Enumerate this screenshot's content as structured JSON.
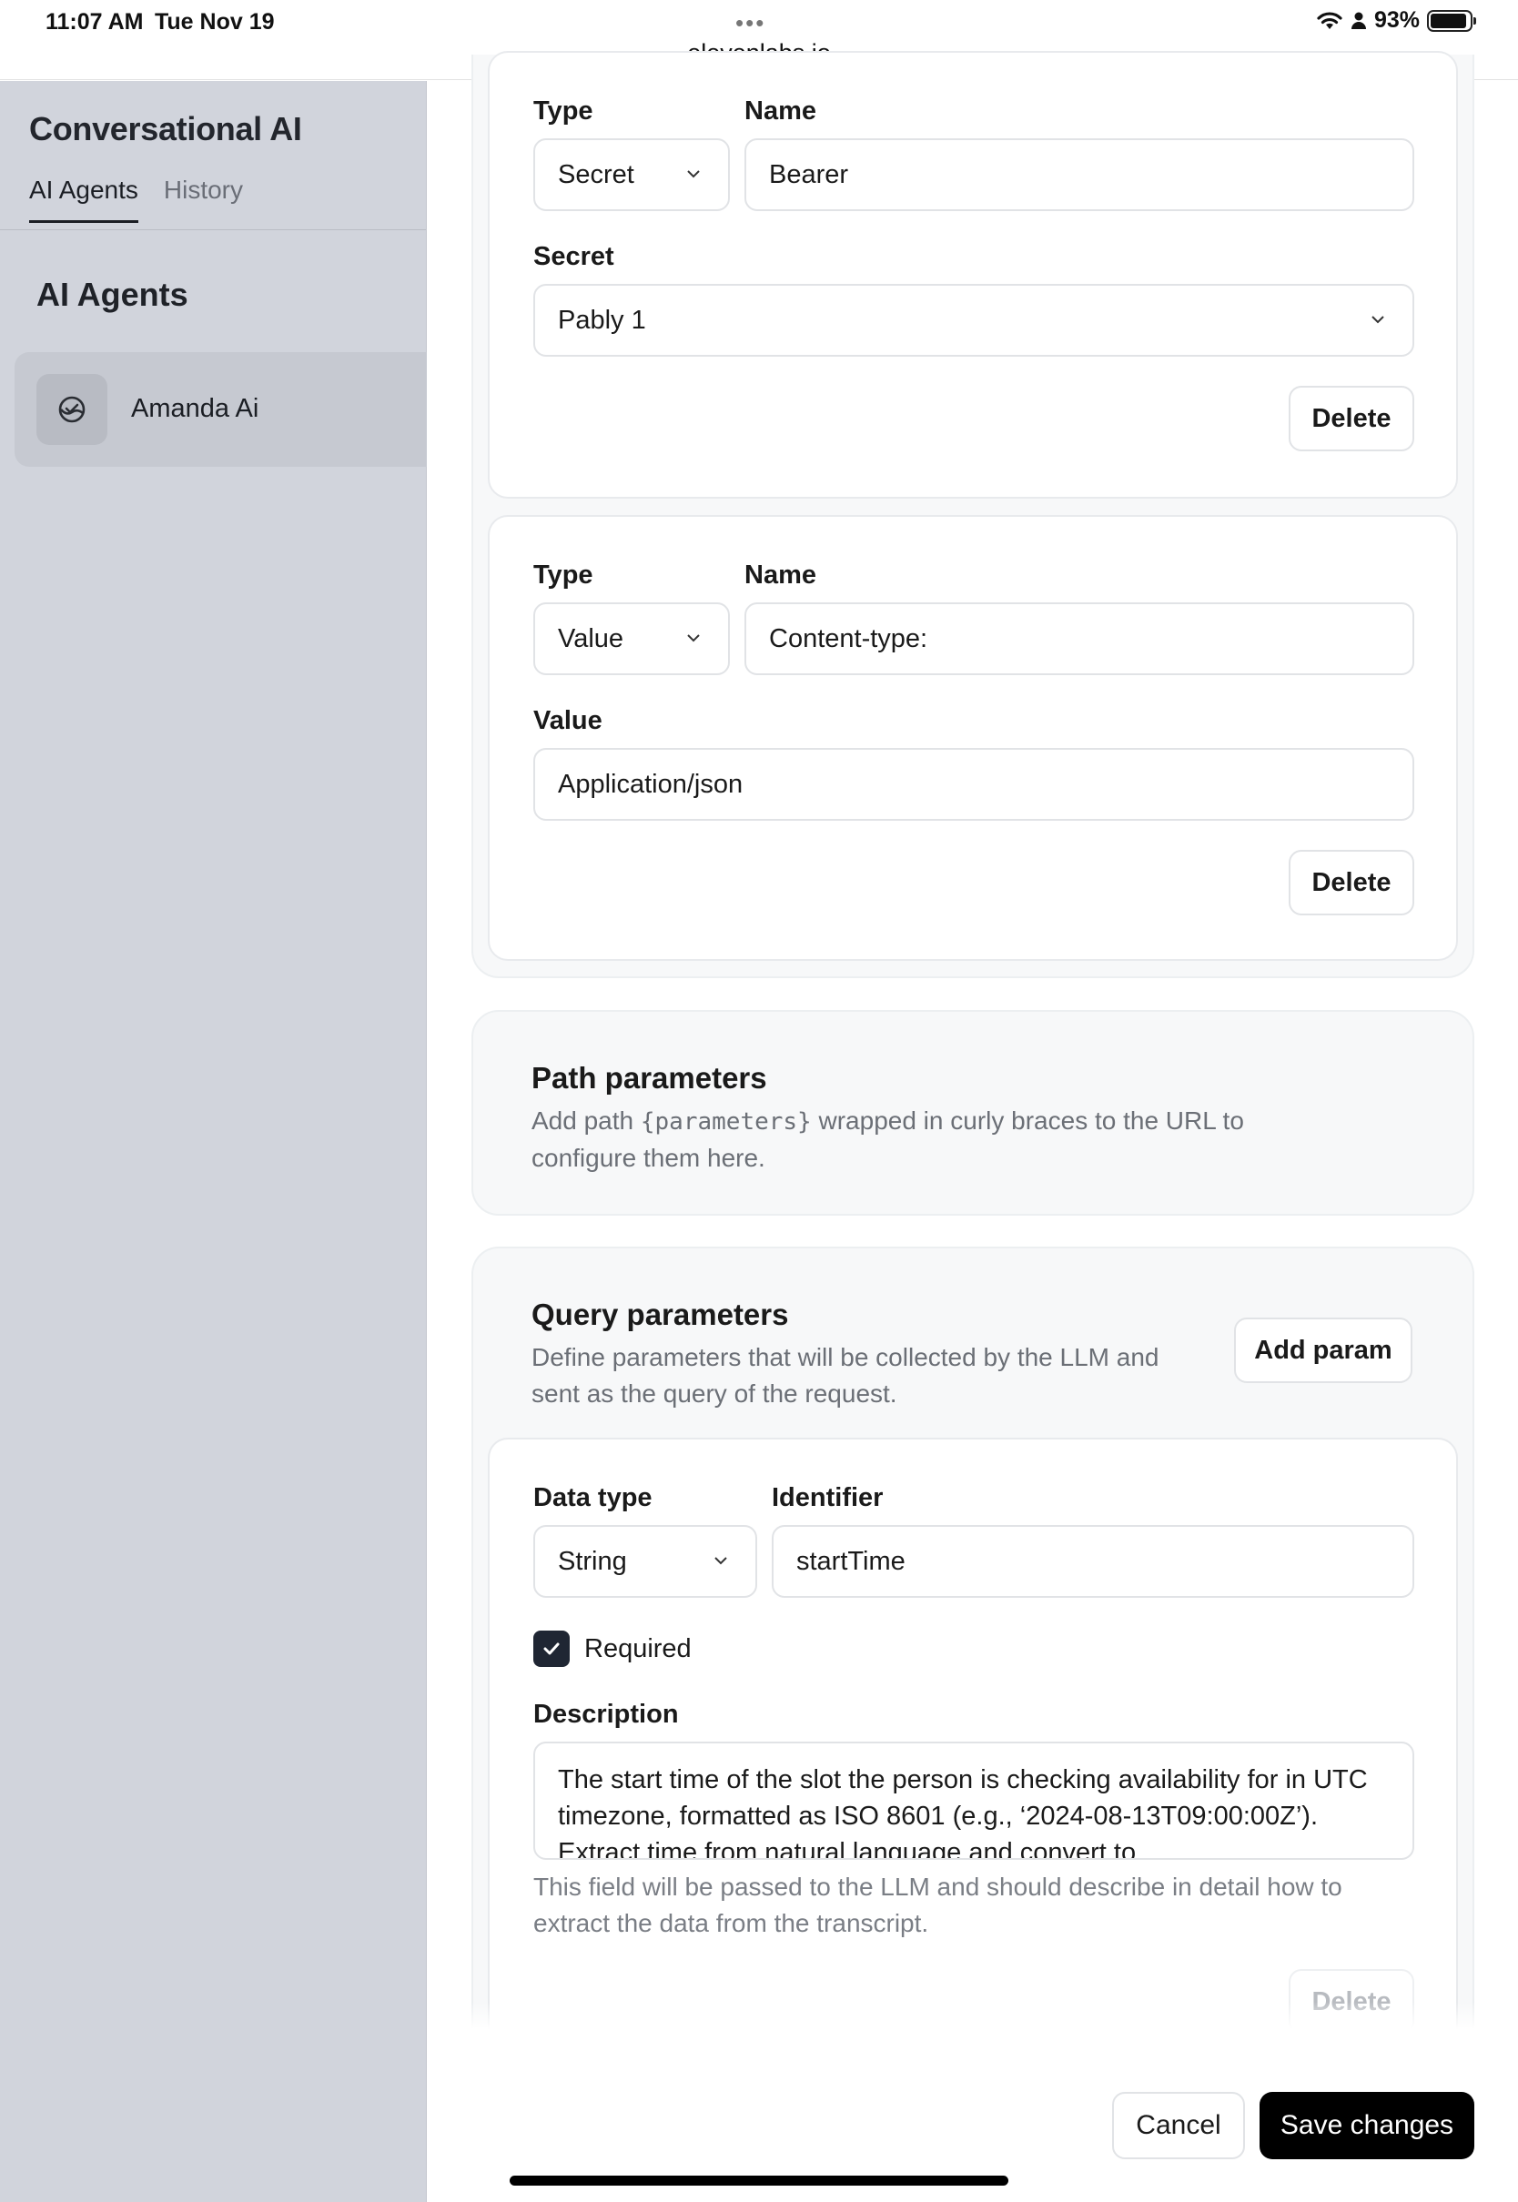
{
  "status_bar": {
    "time": "11:07 AM",
    "date": "Tue Nov 19",
    "url": "elevenlabs.io",
    "battery": "93%",
    "battery_level": 0.93,
    "icons": [
      "wifi-icon",
      "person-icon",
      "battery-icon"
    ]
  },
  "sidebar": {
    "title": "Conversational AI",
    "tabs": [
      {
        "label": "AI Agents",
        "active": true
      },
      {
        "label": "History",
        "active": false
      }
    ],
    "section_title": "AI Agents",
    "agents": [
      {
        "name": "Amanda Ai",
        "icon": "agent-icon"
      }
    ]
  },
  "headers": [
    {
      "type_label": "Type",
      "name_label": "Name",
      "type_value": "Secret",
      "name_value": "Bearer",
      "value_label": "Secret",
      "value": "Pably 1",
      "delete_label": "Delete"
    },
    {
      "type_label": "Type",
      "name_label": "Name",
      "type_value": "Value",
      "name_value": "Content-type:",
      "value_label": "Value",
      "value": "Application/json",
      "delete_label": "Delete"
    }
  ],
  "path_parameters": {
    "title": "Path parameters",
    "desc_before": "Add path ",
    "desc_code": "{parameters}",
    "desc_after_line1": " wrapped in curly braces to the URL to",
    "desc_line2": "configure them here."
  },
  "query_parameters": {
    "title": "Query parameters",
    "desc_line1": "Define parameters that will be collected by the LLM and",
    "desc_line2": "sent as the query of the request.",
    "add_button": "Add param",
    "params": [
      {
        "data_type_label": "Data type",
        "identifier_label": "Identifier",
        "data_type": "String",
        "identifier": "startTime",
        "required_label": "Required",
        "required": true,
        "description_label": "Description",
        "description": "The start time of the slot the person is checking availability for in UTC timezone, formatted as ISO 8601 (e.g., ‘2024-08-13T09:00:00Z’). Extract time from natural language and convert to",
        "hint_line1": "This field will be passed to the LLM and should describe in detail how to",
        "hint_line2": "extract the data from the transcript.",
        "delete_label": "Delete"
      }
    ]
  },
  "footer": {
    "cancel": "Cancel",
    "save": "Save changes"
  },
  "colors": {
    "sidebar_bg": "#d1d4dc",
    "primary_button": "#000000",
    "checkbox": "#1f2633"
  }
}
